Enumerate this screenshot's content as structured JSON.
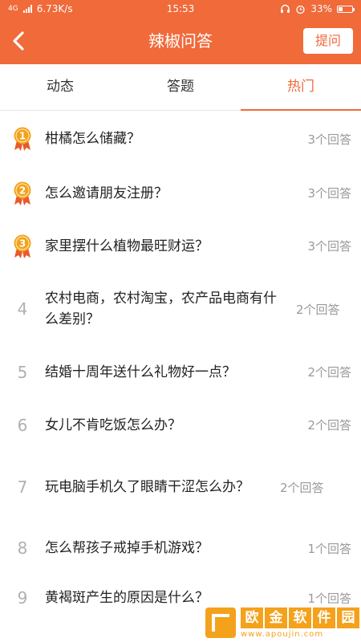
{
  "status_bar": {
    "network": "4G",
    "speed": "6.73K/s",
    "time": "15:53",
    "battery": "33%",
    "battery_level": 0.33
  },
  "header": {
    "title": "辣椒问答",
    "ask_label": "提问"
  },
  "tabs": [
    {
      "label": "动态",
      "active": false
    },
    {
      "label": "答题",
      "active": false
    },
    {
      "label": "热门",
      "active": true
    }
  ],
  "questions": [
    {
      "rank": "1",
      "title": "柑橘怎么储藏？",
      "answers": "3个回答"
    },
    {
      "rank": "2",
      "title": "怎么邀请朋友注册？",
      "answers": "3个回答"
    },
    {
      "rank": "3",
      "title": "家里摆什么植物最旺财运？",
      "answers": "3个回答"
    },
    {
      "rank": "4",
      "title": "农村电商，农村淘宝，农产品电商有什么差别？",
      "answers": "2个回答"
    },
    {
      "rank": "5",
      "title": "结婚十周年送什么礼物好一点？",
      "answers": "2个回答"
    },
    {
      "rank": "6",
      "title": "女儿不肯吃饭怎么办？",
      "answers": "2个回答"
    },
    {
      "rank": "7",
      "title": "玩电脑手机久了眼睛干涩怎么办？",
      "answers": "2个回答"
    },
    {
      "rank": "8",
      "title": "怎么帮孩子戒掉手机游戏？",
      "answers": "1个回答"
    },
    {
      "rank": "9",
      "title": "黄褐斑产生的原因是什么？",
      "answers": "1个回答"
    }
  ],
  "watermark": {
    "chars": [
      "欧",
      "金",
      "软",
      "件",
      "园"
    ],
    "url": "www.apoujin.com"
  },
  "colors": {
    "accent": "#f06a3a",
    "medal": "#f4a11b"
  },
  "icons": {
    "back": "chevron-left-icon",
    "medal": "medal-icon",
    "alarm": "alarm-icon",
    "headset": "headset-icon"
  }
}
